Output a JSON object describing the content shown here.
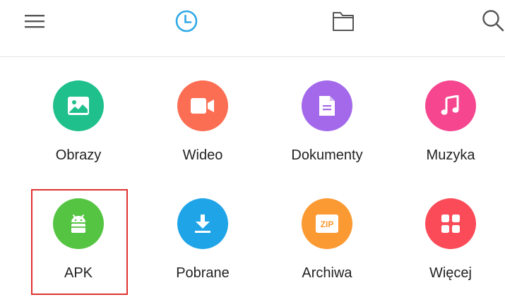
{
  "topbar": {
    "icons": [
      "menu-icon",
      "clock-icon",
      "folder-icon",
      "search-icon"
    ],
    "accent": "#2ea8e6"
  },
  "categories": [
    {
      "label": "Obrazy",
      "icon": "image-icon",
      "color": "#1fc08b"
    },
    {
      "label": "Wideo",
      "icon": "video-icon",
      "color": "#fb6e53"
    },
    {
      "label": "Dokumenty",
      "icon": "document-icon",
      "color": "#a369ea"
    },
    {
      "label": "Muzyka",
      "icon": "music-icon",
      "color": "#f5468f"
    },
    {
      "label": "APK",
      "icon": "android-icon",
      "color": "#56c443",
      "highlighted": true
    },
    {
      "label": "Pobrane",
      "icon": "download-icon",
      "color": "#1fa4e8"
    },
    {
      "label": "Archiwa",
      "icon": "zip-icon",
      "color": "#fb9a32"
    },
    {
      "label": "Więcej",
      "icon": "grid-icon",
      "color": "#fb4a58"
    }
  ],
  "highlight_color": "#e0322f"
}
